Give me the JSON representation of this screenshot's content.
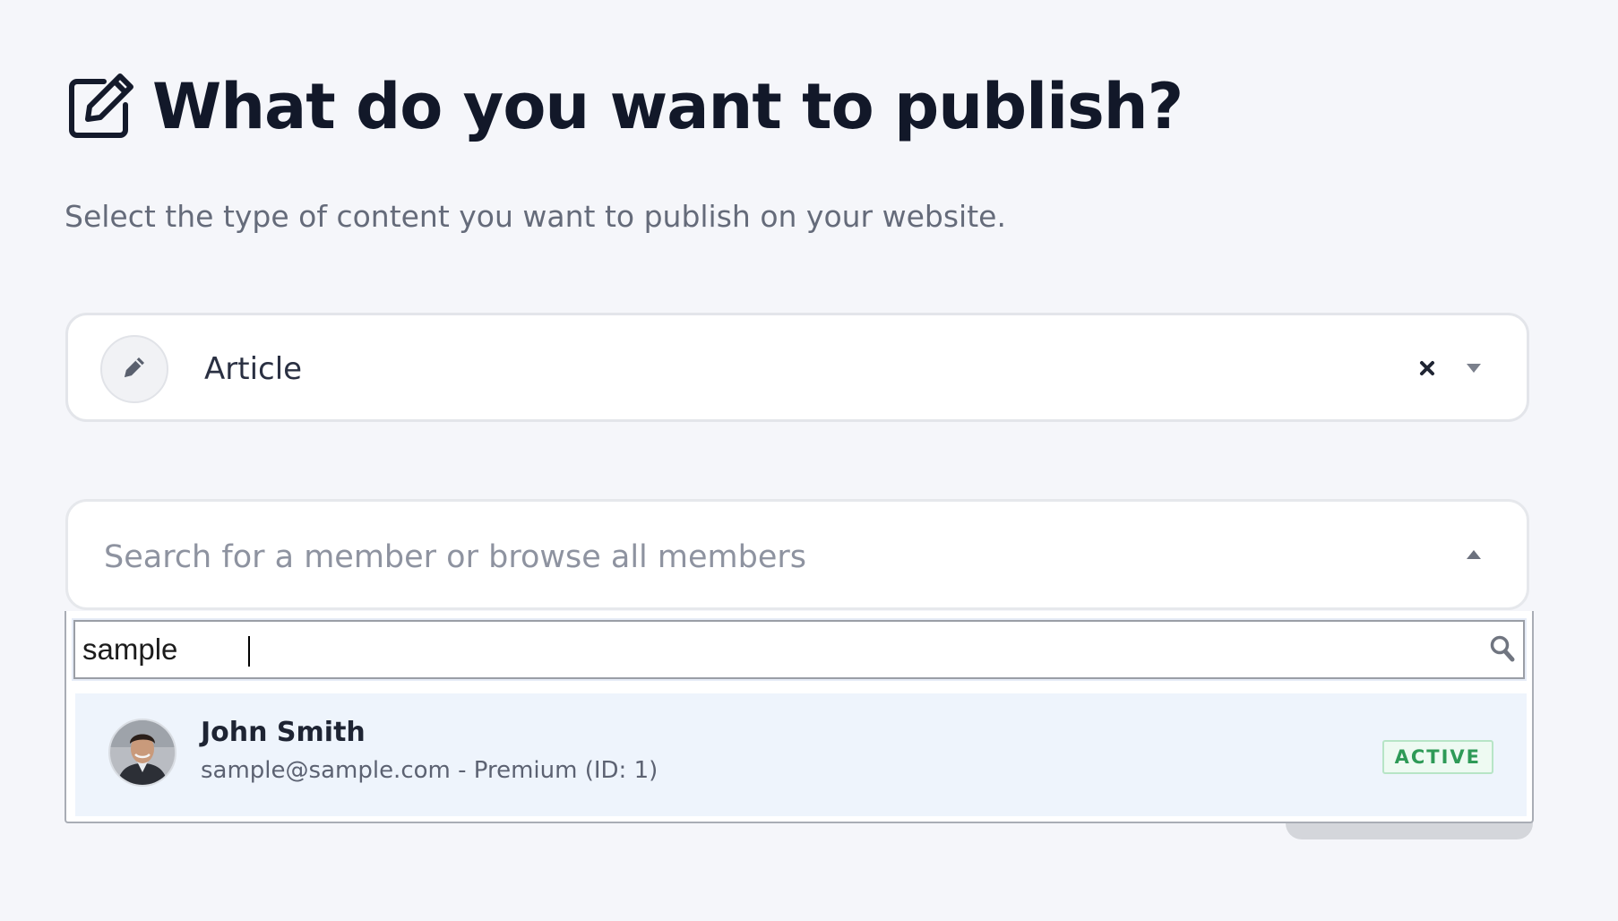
{
  "header": {
    "title": "What do you want to publish?",
    "subtitle": "Select the type of content you want to publish on your website.",
    "icon": "edit-icon"
  },
  "content_type_select": {
    "value": "Article",
    "icon": "pencil-icon",
    "clear_icon": "close-icon",
    "toggle_icon": "chevron-down-icon"
  },
  "member_select": {
    "placeholder": "Search for a member or browse all members",
    "toggle_icon": "chevron-up-icon",
    "search": {
      "value": "sample",
      "icon": "search-icon"
    },
    "results": [
      {
        "name": "John Smith",
        "detail": "sample@sample.com - Premium (ID: 1)",
        "status": "ACTIVE"
      }
    ]
  },
  "colors": {
    "background": "#f5f6fa",
    "title": "#121829",
    "highlight_row": "#eef4fc",
    "status_active": "#2e9a57"
  }
}
